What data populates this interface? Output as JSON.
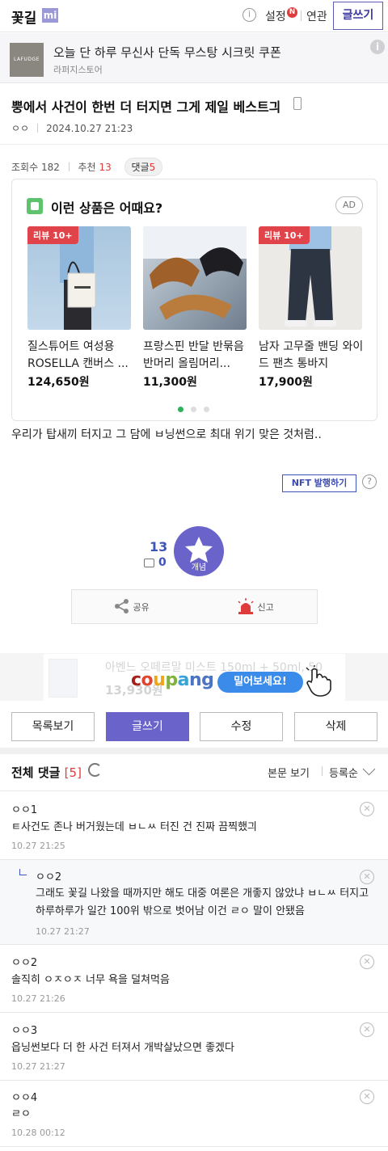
{
  "header": {
    "logo": "꽃길",
    "badge": "mi",
    "links": [
      "설정",
      "연관"
    ],
    "new_badge": "N",
    "write_label": "글쓰기"
  },
  "ad_banner": {
    "logo_text": "LAFUDGE",
    "title": "오늘 단 하루 무신사 단독 무스탕 시크릿 쿠폰",
    "sub": "라퍼지스토어"
  },
  "post": {
    "title": "뿡에서 사건이 한번 더 터지면 그게 제일 베스트긔",
    "author": "ㅇㅇ",
    "datetime": "2024.10.27 21:23",
    "views_label": "조회수",
    "views": "182",
    "recommend_label": "추천",
    "recommend": "13",
    "comments_label": "댓글",
    "comments": "5",
    "body": "우리가 탑새끼 터지고 그 담에 ㅂ닝썬으로 최대 위기 맞은 것처럼.."
  },
  "recommendation": {
    "title": "이런 상품은 어때요?",
    "ad_label": "AD",
    "products": [
      {
        "badge": "리뷰 10+",
        "name": "질스튜어트 여성용 ROSELLA 캔버스 ...",
        "price": "124,650원"
      },
      {
        "badge": "",
        "name": "프랑스핀 반달 반묶음 반머리 올림머리...",
        "price": "11,300원"
      },
      {
        "badge": "리뷰 10+",
        "name": "남자 고무줄 밴딩 와이드 팬츠 통바지",
        "price": "17,900원"
      }
    ],
    "dots": 3,
    "active_dot": 0
  },
  "nft": {
    "label": "NFT 발행하기"
  },
  "vote": {
    "count": "13",
    "image_count": "0",
    "button_label": "개념"
  },
  "actions": {
    "share": "공유",
    "report": "신고"
  },
  "coupang": {
    "ghost_text": "아벤느 오떼르말 미스트 150ml + 50ml, 50",
    "ghost_price": "13,930원",
    "logo": "coupang",
    "cta": "밀어보세요!"
  },
  "buttons": {
    "list": "목록보기",
    "write": "글쓰기",
    "edit": "수정",
    "delete": "삭제"
  },
  "comments_section": {
    "title": "전체 댓글",
    "count": "[5]",
    "view_body": "본문 보기",
    "sort": "등록순"
  },
  "comments": [
    {
      "author": "ㅇㅇ1",
      "text": "ㅌ사건도 존나 버거웠는데 ㅂㄴㅆ 터진 건 진짜 끔찍했긔",
      "time": "10.27 21:25",
      "reply": false
    },
    {
      "author": "ㅇㅇ2",
      "text": "그래도 꽃길 나왔을 때까지만 해도 대중 여론은 개좋지 않았냐 ㅂㄴㅆ 터지고 하루하루가 일간 100위 밖으로 벗어남 이건 ㄹㅇ 말이 안됐음",
      "time": "10.27 21:27",
      "reply": true
    },
    {
      "author": "ㅇㅇ2",
      "text": "솔직히 ㅇㅈㅇㅈ 너무 욕을 덜쳐먹음",
      "time": "10.27 21:26",
      "reply": false
    },
    {
      "author": "ㅇㅇ3",
      "text": "읍닝썬보다 더 한 사건 터져서 개박살났으면 좋겠다",
      "time": "10.27 21:27",
      "reply": false
    },
    {
      "author": "ㅇㅇ4",
      "text": "ㄹㅇ",
      "time": "10.28 00:12",
      "reply": false
    }
  ],
  "colors": {
    "accent": "#6a63c9",
    "red": "#e03b3b",
    "blue": "#3d54b8"
  }
}
